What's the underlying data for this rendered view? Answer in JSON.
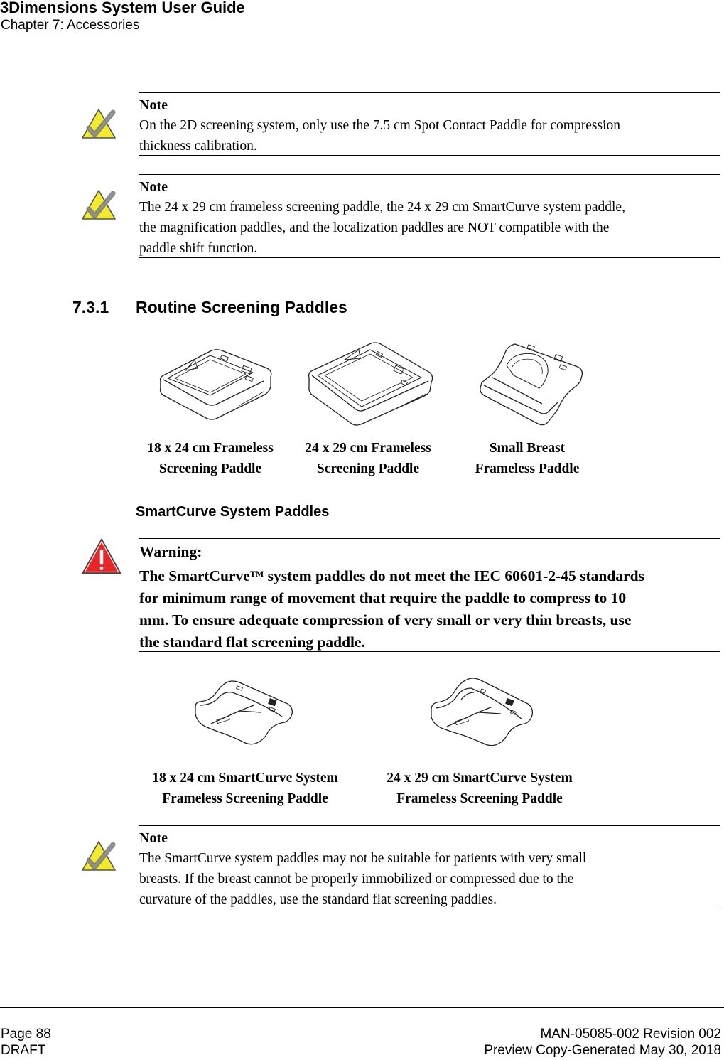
{
  "header": {
    "title": "3Dimensions System User Guide",
    "chapter": "Chapter 7: Accessories"
  },
  "notes": [
    {
      "icon": "note-check-icon",
      "heading": "Note",
      "lines": [
        "On the 2D screening system, only use the 7.5 cm Spot Contact Paddle for compression",
        "thickness calibration."
      ]
    },
    {
      "icon": "note-check-icon",
      "heading": "Note",
      "lines": [
        "The 24 x 29 cm frameless screening paddle, the 24 x 29 cm SmartCurve system paddle,",
        "the magnification paddles, and the localization paddles are NOT compatible with the",
        "paddle shift function."
      ]
    }
  ],
  "section": {
    "number": "7.3.1",
    "title": "Routine Screening Paddles"
  },
  "routine_paddles": [
    {
      "caption_line1": "18 x 24 cm Frameless",
      "caption_line2": "Screening Paddle"
    },
    {
      "caption_line1": "24 x 29 cm Frameless",
      "caption_line2": "Screening Paddle"
    },
    {
      "caption_line1": "Small Breast",
      "caption_line2": "Frameless Paddle"
    }
  ],
  "subsection": {
    "title": "SmartCurve System Paddles"
  },
  "warning": {
    "icon": "warning-triangle-icon",
    "heading": "Warning:",
    "line1_pre": "The SmartCurve",
    "trademark": "TM",
    "line1_post": " system paddles do not meet the IEC 60601-2-45 standards",
    "lines": [
      "for minimum range of movement that require the paddle to compress to 10",
      "mm. To ensure adequate compression of very small or very thin breasts, use",
      "the standard flat screening paddle."
    ]
  },
  "smartcurve_paddles": [
    {
      "caption_line1": "18 x 24 cm SmartCurve System",
      "caption_line2": "Frameless Screening Paddle"
    },
    {
      "caption_line1": "24 x 29 cm SmartCurve System",
      "caption_line2": "Frameless Screening Paddle"
    }
  ],
  "note_final": {
    "icon": "note-check-icon",
    "heading": "Note",
    "lines": [
      "The SmartCurve system paddles may not be suitable for patients with very small",
      "breasts. If the breast cannot be properly immobilized or compressed due to the",
      "curvature of the paddles, use the standard flat screening paddles."
    ]
  },
  "footer": {
    "page": "Page 88",
    "status": "DRAFT",
    "doc_id": "MAN-05085-002 Revision 002",
    "generated": "Preview Copy-Generated May 30, 2018"
  },
  "colors": {
    "note_icon_fill": "#f2ea2e",
    "warning_icon_fill": "#e8262a",
    "text": "#000000"
  }
}
